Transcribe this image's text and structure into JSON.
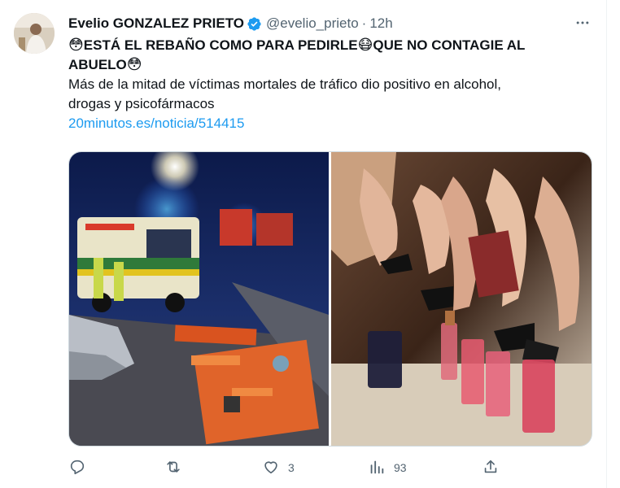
{
  "author": {
    "name": "Evelio GONZALEZ PRIETO",
    "handle": "@evelio_prieto",
    "separator": "·",
    "time": "12h"
  },
  "tweet": {
    "line1": {
      "emoji_start": "😳",
      "text_a": "ESTÁ EL REBAÑO COMO PARA PEDIRLE",
      "emoji_mid": "😷",
      "text_b": "QUE NO CONTAGIE AL"
    },
    "line2": {
      "text": "ABUELO",
      "emoji_end": "😳"
    },
    "body_line1": "Más de la mitad de víctimas mortales de tráfico dio positivo en alcohol,",
    "body_line2": "drogas y psicofármacos",
    "link": "20minutos.es/noticia/514415"
  },
  "actions": {
    "reply": {
      "icon": "reply-icon",
      "count": ""
    },
    "retweet": {
      "icon": "retweet-icon",
      "count": ""
    },
    "like": {
      "icon": "heart-icon",
      "count": "3"
    },
    "views": {
      "icon": "views-icon",
      "count": "93"
    },
    "share": {
      "icon": "share-icon"
    }
  },
  "colors": {
    "accent": "#1d9bf0",
    "secondary_text": "#536471",
    "text": "#0f1419"
  }
}
